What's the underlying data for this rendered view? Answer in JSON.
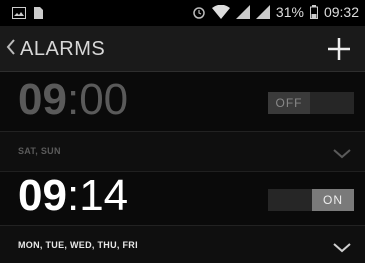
{
  "status_bar": {
    "battery_text": "31%",
    "time": "09:32",
    "icons": [
      "gallery-icon",
      "sim-icon",
      "alarm-clock-icon",
      "wifi-icon",
      "signal-icon",
      "signal-icon",
      "battery-icon"
    ]
  },
  "action_bar": {
    "title": "ALARMS",
    "back_icon": "chevron-left-icon",
    "add_icon": "plus-icon"
  },
  "alarms": [
    {
      "hour": "09",
      "separator": ":",
      "minute": "00",
      "toggle_label": "OFF",
      "days": "SAT, SUN",
      "enabled": false
    },
    {
      "hour": "09",
      "separator": ":",
      "minute": "14",
      "toggle_label": "ON",
      "days": "MON, TUE, WED, THU, FRI",
      "enabled": true
    }
  ],
  "colors": {
    "background": "#0a0a0a",
    "action_bar": "#1a1a1a",
    "enabled_text": "#ffffff",
    "disabled_text": "#5a5a5a"
  }
}
